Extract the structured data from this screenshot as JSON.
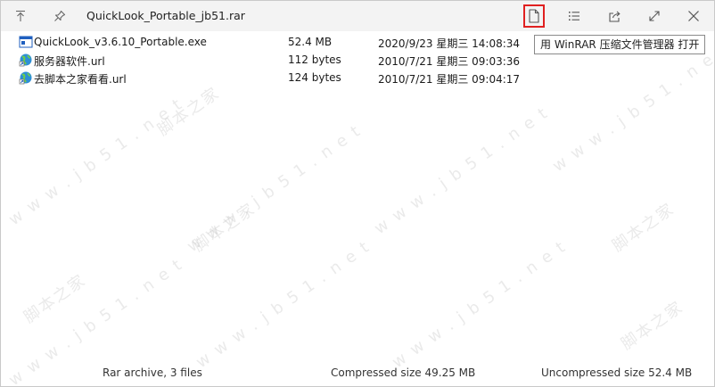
{
  "window": {
    "title": "QuickLook_Portable_jb51.rar"
  },
  "toolbar": {
    "up_icon": "arrow-up-to-line-icon",
    "pin_icon": "pin-icon",
    "open_icon": "document-icon",
    "list_icon": "list-icon",
    "share_icon": "share-icon",
    "fullscreen_icon": "expand-icon",
    "close_icon": "close-icon",
    "highlight_color": "#e02020"
  },
  "tooltip": {
    "text": "用 WinRAR 压缩文件管理器 打开"
  },
  "files": [
    {
      "name": "QuickLook_v3.6.10_Portable.exe",
      "size": "52.4 MB",
      "date": "2020/9/23 星期三 14:08:34",
      "icon": "exe-icon"
    },
    {
      "name": "服务器软件.url",
      "size": "112 bytes",
      "date": "2010/7/21 星期三 09:03:36",
      "icon": "url-icon"
    },
    {
      "name": "去脚本之家看看.url",
      "size": "124 bytes",
      "date": "2010/7/21 星期三 09:04:17",
      "icon": "url-icon"
    }
  ],
  "status": {
    "archive_info": "Rar archive, 3 files",
    "compressed": "Compressed size 49.25 MB",
    "uncompressed": "Uncompressed size 52.4 MB"
  },
  "watermark": {
    "site": "w w w . j b 5 1 . n e t",
    "brand": "脚本之家"
  }
}
